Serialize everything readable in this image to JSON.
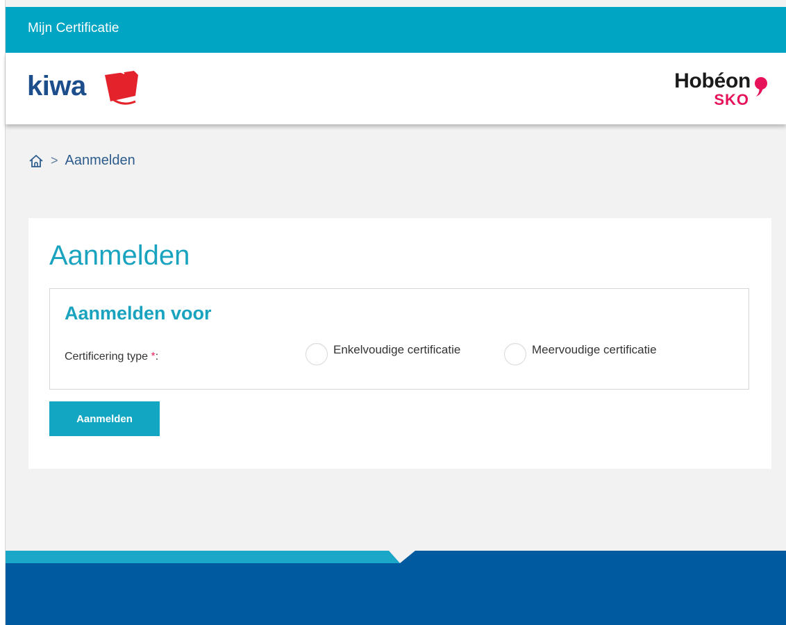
{
  "topbar": {
    "title": "Mijn Certificatie"
  },
  "header": {
    "left_logo": {
      "text": "kiwa",
      "color": "#1d4e8c",
      "accent": "#e3222c"
    },
    "right_logo": {
      "main": "Hobéon",
      "sub": "SKO",
      "main_color": "#1a1a1a",
      "accent": "#e6135b"
    }
  },
  "breadcrumb": {
    "home_icon": "home-icon",
    "separator": ">",
    "current": "Aanmelden"
  },
  "main": {
    "title": "Aanmelden",
    "section": {
      "title": "Aanmelden voor",
      "field_label": "Certificering type",
      "required_marker": "*",
      "label_suffix": ":",
      "options": [
        {
          "label": "Enkelvoudige certificatie",
          "selected": false
        },
        {
          "label": "Meervoudige certificatie",
          "selected": false
        }
      ]
    },
    "submit_label": "Aanmelden"
  },
  "colors": {
    "primary": "#00a5c3",
    "heading": "#19a3bf",
    "footer_dark": "#005aa0",
    "background": "#f2f2f2"
  }
}
